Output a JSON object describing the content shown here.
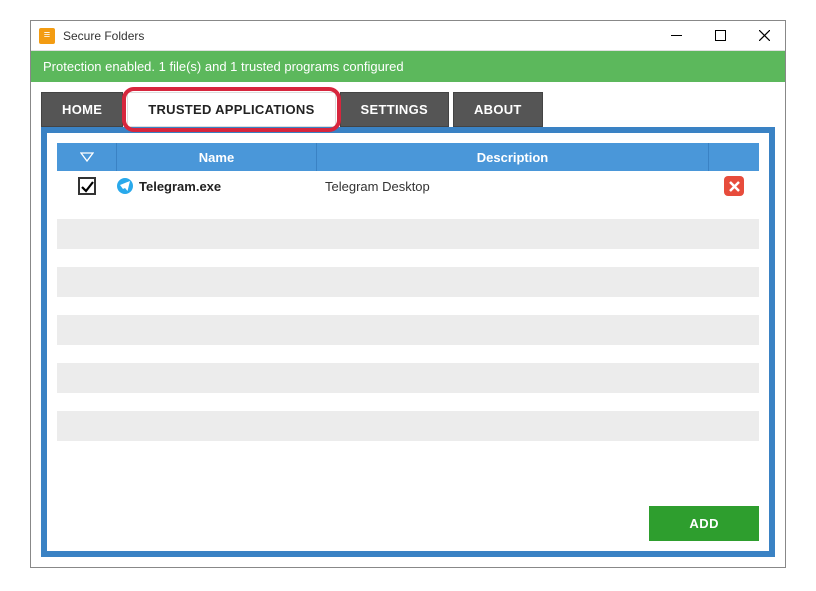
{
  "titlebar": {
    "title": "Secure Folders"
  },
  "statusbar": {
    "text": "Protection enabled. 1 file(s) and 1 trusted programs configured"
  },
  "tabs": {
    "home": "HOME",
    "trusted": "TRUSTED APPLICATIONS",
    "settings": "SETTINGS",
    "about": "ABOUT",
    "active": "trusted"
  },
  "table": {
    "headers": {
      "name": "Name",
      "description": "Description"
    },
    "rows": [
      {
        "checked": true,
        "icon": "telegram",
        "name": "Telegram.exe",
        "description": "Telegram Desktop"
      }
    ]
  },
  "footer": {
    "add": "ADD"
  }
}
